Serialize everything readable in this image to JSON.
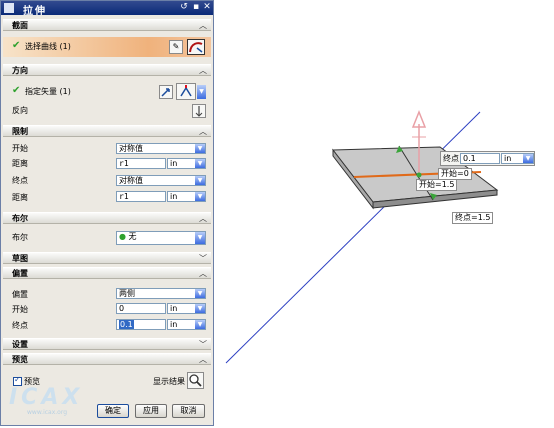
{
  "dialog": {
    "title": "拉伸",
    "title_buttons": [
      "↺",
      "▪",
      "✕"
    ],
    "sections": {
      "section": {
        "title": "截面",
        "select_curve": "选择曲线 (1)"
      },
      "direction": {
        "title": "方向",
        "specify_vector": "指定矢量 (1)",
        "reverse": "反向"
      },
      "limits": {
        "title": "限制",
        "start_label": "开始",
        "start_value": "对称值",
        "distance1_label": "距离",
        "distance1_value": "r1",
        "distance1_unit": "in",
        "end_label": "终点",
        "end_value": "对称值",
        "distance2_label": "距离",
        "distance2_value": "r1",
        "distance2_unit": "in"
      },
      "boolean": {
        "title": "布尔",
        "label": "布尔",
        "value": "无"
      },
      "draft": {
        "title": "草图"
      },
      "offset": {
        "title": "偏置",
        "offset_label": "偏置",
        "offset_value": "两侧",
        "start_label": "开始",
        "start_value": "0",
        "start_unit": "in",
        "end_label": "终点",
        "end_value": "0.1",
        "end_unit": "in"
      },
      "settings": {
        "title": "设置"
      },
      "preview": {
        "title": "预览",
        "checkbox_label": "预览",
        "show_result": "显示结果"
      }
    },
    "buttons": {
      "ok": "确定",
      "apply": "应用",
      "cancel": "取消"
    },
    "watermark": "ICAX",
    "watermark_small": "www.icax.org"
  },
  "viewport": {
    "end_input": {
      "label": "终点",
      "value": "0.1",
      "unit": "in"
    },
    "start_label_top": "开始=0",
    "start_label_bottom": "开始=1.5",
    "end_label_bottom": "终点=1.5"
  },
  "colors": {
    "title_bar": "#0b2a78",
    "selection_highlight": "#f0b27c",
    "axis_line": "#2c3fc2",
    "orange_curve": "#e06a1a",
    "arrow_green": "#3aa53a",
    "arrow_pink": "#e9a0a6"
  }
}
